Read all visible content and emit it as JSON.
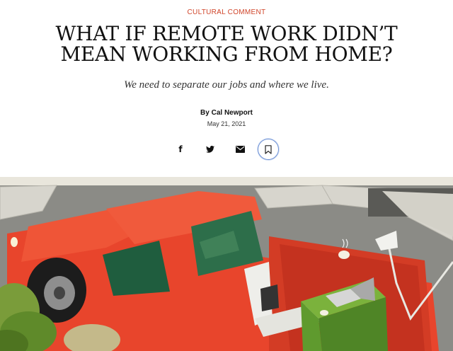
{
  "article": {
    "rubric": "CULTURAL COMMENT",
    "headline": "WHAT IF REMOTE WORK DIDN’T MEAN WORKING FROM HOME?",
    "dek": "We need to separate our jobs and where we live.",
    "byline_prefix": "By",
    "author": "Cal Newport",
    "date": "May 21, 2021"
  },
  "share": {
    "icons": [
      "facebook-icon",
      "twitter-icon",
      "email-icon",
      "bookmark-icon"
    ]
  },
  "colors": {
    "rubric": "#d0452a",
    "headline": "#111111",
    "bookmark_ring": "#6a8fd4",
    "truck": "#e8452c",
    "desk": "#5f9a2e"
  },
  "hero": {
    "subject": "illustration-red-pickup-truck-with-desk-and-laptop"
  }
}
